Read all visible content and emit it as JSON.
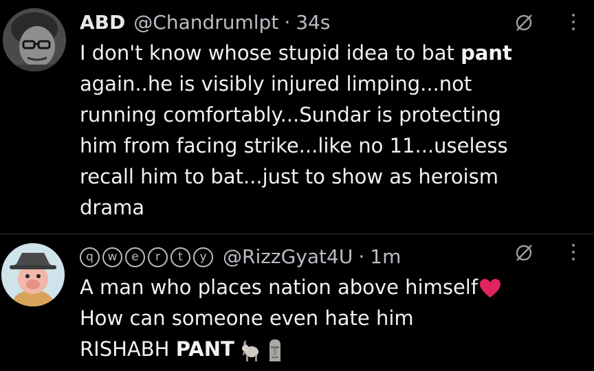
{
  "tweets": [
    {
      "display_name": "ABD",
      "handle": "@Chandrumlpt",
      "separator": "·",
      "time": "34s",
      "lines": [
        {
          "pre": "I don't know whose stupid idea to bat ",
          "bold": "pant"
        },
        {
          "pre": "again..he is visibly injured limping...not"
        },
        {
          "pre": "running comfortably...Sundar is protecting"
        },
        {
          "pre": "him from facing strike...like no 11...useless"
        },
        {
          "pre": "recall him to bat...just to show as heroism"
        },
        {
          "pre": "drama"
        }
      ]
    },
    {
      "badges": [
        "q",
        "w",
        "e",
        "r",
        "t",
        "y"
      ],
      "handle": "@RizzGyat4U",
      "separator": "·",
      "time": "1m",
      "lines": [
        {
          "pre": "A man who places nation above himself"
        },
        {
          "pre": "How can someone even hate him"
        },
        {
          "pre": "RISHABH ",
          "bold": "PANT"
        }
      ]
    }
  ],
  "icons": {
    "mute": "mute-icon",
    "more": "more-options-icon",
    "heart": "red-heart-emoji",
    "goat": "goat-emoji",
    "moai": "moai-emoji"
  },
  "colors": {
    "background": "#000000",
    "text": "#e7e9ea",
    "secondary": "#b9bec4",
    "divider": "#2f3336",
    "heart": "#e0245e"
  }
}
